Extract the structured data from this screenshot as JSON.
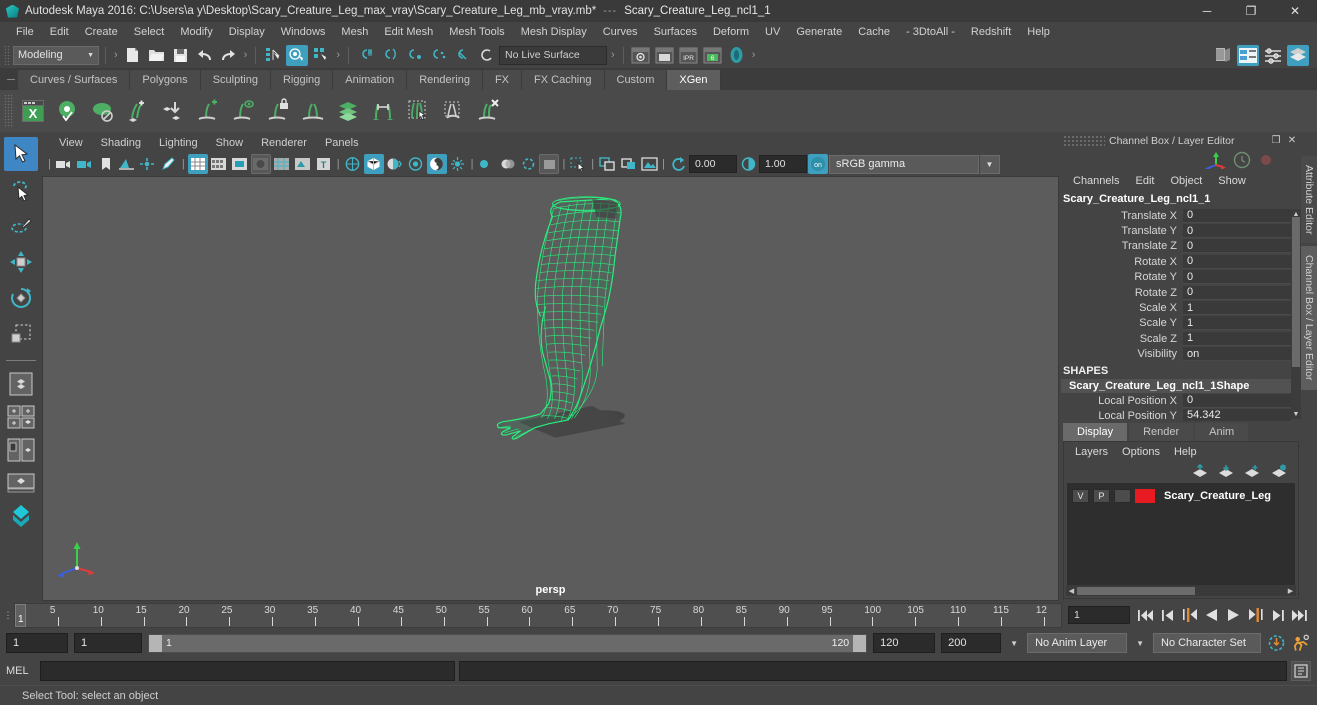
{
  "titlebar": {
    "app_title": "Autodesk Maya 2016: C:\\Users\\a y\\Desktop\\Scary_Creature_Leg_max_vray\\Scary_Creature_Leg_mb_vray.mb*",
    "separator": "---",
    "node_name": "Scary_Creature_Leg_ncl1_1",
    "minimize": "─",
    "maximize": "❐",
    "close": "✕"
  },
  "menubar": {
    "items": [
      "File",
      "Edit",
      "Create",
      "Select",
      "Modify",
      "Display",
      "Windows",
      "Mesh",
      "Edit Mesh",
      "Mesh Tools",
      "Mesh Display",
      "Curves",
      "Surfaces",
      "Deform",
      "UV",
      "Generate",
      "Cache",
      "- 3DtoAll -",
      "Redshift",
      "Help"
    ]
  },
  "statusline": {
    "mode": "Modeling",
    "mode_caret": "▼",
    "live_surface": "No Live Surface",
    "snap_value_1": "0.00",
    "snap_value_2": "1.00",
    "gamma": "sRGB gamma",
    "gamma_caret": "▼",
    "arrow": "›"
  },
  "shelf": {
    "tabs": [
      "Curves / Surfaces",
      "Polygons",
      "Sculpting",
      "Rigging",
      "Animation",
      "Rendering",
      "FX",
      "FX Caching",
      "Custom",
      "XGen"
    ],
    "active_tab": "XGen",
    "handle": "─",
    "icons": [
      "xgen-editor-icon",
      "xgen-preview-icon",
      "xgen-disable-preview-icon",
      "xgen-add-description-icon",
      "xgen-import-collection-icon",
      "xgen-create-guide-icon",
      "xgen-guide-preview-icon",
      "xgen-lock-guide-icon",
      "xgen-mirror-guide-icon",
      "xgen-layers-icon",
      "xgen-distance-tool-icon",
      "xgen-select-guides-icon",
      "xgen-region-tool-icon",
      "xgen-delete-guide-icon"
    ]
  },
  "toolbox": {
    "items": [
      "select-tool",
      "lasso-select-tool",
      "paint-select-tool",
      "move-tool",
      "rotate-tool",
      "scale-tool"
    ],
    "selected": "select-tool",
    "layout_items": [
      "single-perspective-view",
      "four-view-layout",
      "persp-outliner-layout",
      "persp-graph-layout",
      "hypershade-layout"
    ]
  },
  "viewport": {
    "menus": [
      "View",
      "Shading",
      "Lighting",
      "Show",
      "Renderer",
      "Panels"
    ],
    "camera_label": "persp",
    "axis_x": "x",
    "axis_y": "y",
    "axis_z": "z",
    "background_color": "#5c5c5c",
    "mesh_wire_color": "#2aee7d"
  },
  "channel_box": {
    "panel_title": "Channel Box / Layer Editor",
    "undock_icon": "❐",
    "close_icon": "✕",
    "menus": [
      "Channels",
      "Edit",
      "Object",
      "Show"
    ],
    "node_name": "Scary_Creature_Leg_ncl1_1",
    "transform_attrs": [
      {
        "label": "Translate X",
        "value": "0"
      },
      {
        "label": "Translate Y",
        "value": "0"
      },
      {
        "label": "Translate Z",
        "value": "0"
      },
      {
        "label": "Rotate X",
        "value": "0"
      },
      {
        "label": "Rotate Y",
        "value": "0"
      },
      {
        "label": "Rotate Z",
        "value": "0"
      },
      {
        "label": "Scale X",
        "value": "1"
      },
      {
        "label": "Scale Y",
        "value": "1"
      },
      {
        "label": "Scale Z",
        "value": "1"
      },
      {
        "label": "Visibility",
        "value": "on"
      }
    ],
    "shapes_header": "SHAPES",
    "shape_name": "Scary_Creature_Leg_ncl1_1Shape",
    "shape_attrs": [
      {
        "label": "Local Position X",
        "value": "0"
      },
      {
        "label": "Local Position Y",
        "value": "54.342"
      }
    ],
    "scroll_up": "▲",
    "scroll_down": "▼"
  },
  "layer_editor": {
    "tabs": [
      "Display",
      "Render",
      "Anim"
    ],
    "active_tab": "Display",
    "menus": [
      "Layers",
      "Options",
      "Help"
    ],
    "toolbar_icons": [
      "move-layer-up-icon",
      "move-layer-down-icon",
      "new-layer-icon",
      "new-layer-from-selected-icon"
    ],
    "layers": [
      {
        "visibility": "V",
        "playback": "P",
        "type": "",
        "color": "#e81b23",
        "name": "Scary_Creature_Leg"
      }
    ],
    "scroll_left": "◀",
    "scroll_right": "▶"
  },
  "right_tabs": {
    "items": [
      "Attribute Editor",
      "Channel Box / Layer Editor"
    ],
    "active": "Channel Box / Layer Editor"
  },
  "timeline": {
    "current_frame": "1",
    "ticks": [
      "5",
      "10",
      "15",
      "20",
      "25",
      "30",
      "35",
      "40",
      "45",
      "50",
      "55",
      "60",
      "65",
      "70",
      "75",
      "80",
      "85",
      "90",
      "95",
      "100",
      "105",
      "110",
      "115",
      "12"
    ],
    "frame_field": "1",
    "playback_buttons": [
      "go-to-start-icon",
      "step-back-keyframe-icon",
      "step-back-frame-icon",
      "play-backwards-icon",
      "play-forwards-icon",
      "step-forward-frame-icon",
      "step-forward-keyframe-icon",
      "go-to-end-icon"
    ]
  },
  "range_slider": {
    "anim_start": "1",
    "range_start": "1",
    "slider_start_label": "1",
    "slider_end_label": "120",
    "range_end": "120",
    "anim_end": "200",
    "anim_layer": "No Anim Layer",
    "character_set": "No Character Set",
    "caret": "▼",
    "auto_key_icon": "auto-keyframe-icon",
    "anim_prefs_icon": "animation-preferences-icon"
  },
  "command_line": {
    "label": "MEL",
    "input_value": "",
    "output_value": "",
    "script_editor_icon": "script-editor-icon"
  },
  "help_line": {
    "text": "Select Tool: select an object"
  }
}
